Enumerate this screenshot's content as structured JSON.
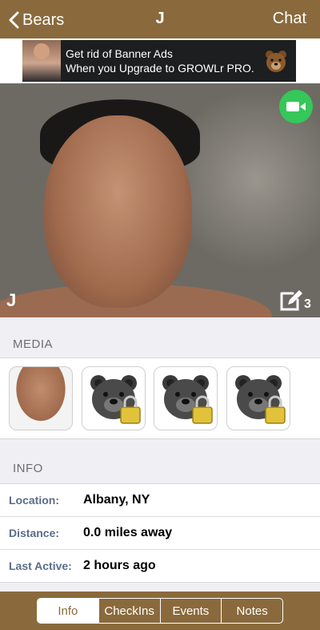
{
  "nav": {
    "back_label": "Bears",
    "title": "J",
    "right_label": "Chat"
  },
  "banner": {
    "line1": "Get rid of Banner Ads",
    "line2": "When you Upgrade to GROWLr PRO."
  },
  "profile": {
    "photo_name": "J",
    "edit_count": "3"
  },
  "media": {
    "header": "MEDIA",
    "items": [
      {
        "type": "photo"
      },
      {
        "type": "locked-bear-icon"
      },
      {
        "type": "locked-bear-icon"
      },
      {
        "type": "locked-bear-icon"
      }
    ]
  },
  "info": {
    "header": "INFO",
    "rows": [
      {
        "label": "Location:",
        "value": "Albany, NY"
      },
      {
        "label": "Distance:",
        "value": "0.0 miles away"
      },
      {
        "label": "Last Active:",
        "value": "2 hours ago"
      }
    ]
  },
  "tabs": {
    "items": [
      "Info",
      "CheckIns",
      "Events",
      "Notes"
    ],
    "selected": "Info"
  },
  "colors": {
    "brand_brown": "#8a6a3c",
    "video_green": "#35c759",
    "label_blue": "#5a6d8a"
  }
}
